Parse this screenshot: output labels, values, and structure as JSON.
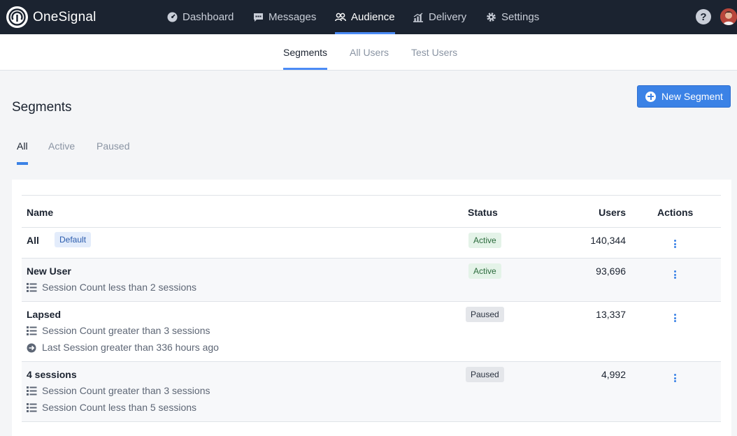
{
  "app": {
    "brand": "OneSignal",
    "accent": "#3b82e6",
    "nav_bg": "#1b2330"
  },
  "topnav": {
    "items": [
      {
        "label": "Dashboard",
        "icon": "dashboard-gauge-icon"
      },
      {
        "label": "Messages",
        "icon": "chat-bubble-icon"
      },
      {
        "label": "Audience",
        "icon": "users-icon",
        "active": true
      },
      {
        "label": "Delivery",
        "icon": "bar-chart-icon"
      },
      {
        "label": "Settings",
        "icon": "gear-icon"
      }
    ],
    "help_label": "?"
  },
  "subnav": {
    "tabs": [
      {
        "label": "Segments",
        "active": true
      },
      {
        "label": "All Users"
      },
      {
        "label": "Test Users"
      }
    ]
  },
  "page": {
    "title": "Segments",
    "new_button": "New Segment",
    "filters": [
      {
        "label": "All",
        "active": true
      },
      {
        "label": "Active"
      },
      {
        "label": "Paused"
      }
    ]
  },
  "table": {
    "columns": {
      "name": "Name",
      "status": "Status",
      "users": "Users",
      "actions": "Actions"
    },
    "rows": [
      {
        "name": "All",
        "badge": "Default",
        "status": "Active",
        "users": "140,344",
        "rules": []
      },
      {
        "name": "New User",
        "status": "Active",
        "users": "93,696",
        "rules": [
          {
            "icon": "list-icon",
            "text": "Session Count less than 2 sessions"
          }
        ]
      },
      {
        "name": "Lapsed",
        "status": "Paused",
        "users": "13,337",
        "rules": [
          {
            "icon": "list-icon",
            "text": "Session Count greater than 3 sessions"
          },
          {
            "icon": "arrow-circle-icon",
            "text": "Last Session greater than 336 hours ago"
          }
        ]
      },
      {
        "name": "4 sessions",
        "status": "Paused",
        "users": "4,992",
        "rules": [
          {
            "icon": "list-icon",
            "text": "Session Count greater than 3 sessions"
          },
          {
            "icon": "list-icon",
            "text": "Session Count less than 5 sessions"
          }
        ]
      }
    ]
  }
}
